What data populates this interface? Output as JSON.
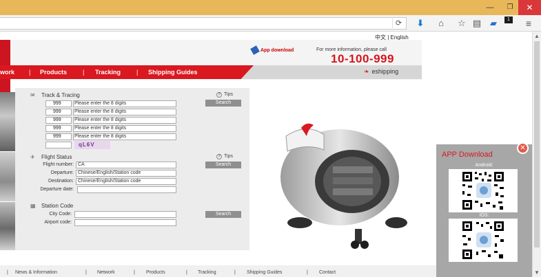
{
  "window": {
    "min_glyph": "—",
    "max_glyph": "❐",
    "close_glyph": "✕"
  },
  "toolbar": {
    "reload_glyph": "⟳",
    "icons": [
      "download-icon",
      "home-icon",
      "star-icon",
      "clipboard-icon",
      "chat-icon",
      "menu-icon"
    ],
    "badge": "1"
  },
  "header": {
    "lang": "中文 | English",
    "app_download": "App download",
    "more_info": "For more information, please call",
    "hotline": "10-100-999",
    "nav": [
      "work",
      "Products",
      "Tracking",
      "Shipping Guides"
    ],
    "eshipping": "eshipping"
  },
  "track": {
    "title": "Track & Tracing",
    "tips": "Tips",
    "search": "Search",
    "rows": [
      {
        "prefix": "999",
        "placeholder": "Please enter the 8 digits"
      },
      {
        "prefix": "999",
        "placeholder": "Please enter the 8 digits"
      },
      {
        "prefix": "999",
        "placeholder": "Please enter the 8 digits"
      },
      {
        "prefix": "999",
        "placeholder": "Please enter the 8 digits"
      },
      {
        "prefix": "999",
        "placeholder": "Please enter the 8 digits"
      }
    ],
    "captcha": "qL6V"
  },
  "flight": {
    "title": "Flight Status",
    "tips": "Tips",
    "search": "Search",
    "flight_number_label": "Flight number:",
    "flight_number_value": "CA",
    "departure_label": "Departure:",
    "departure_value": "Chinese/English/Station code",
    "destination_label": "Destination:",
    "destination_value": "Chinese/English/Station code",
    "date_label": "Departure date:"
  },
  "station": {
    "title": "Station Code",
    "search": "Search",
    "city_label": "City Code:",
    "airport_label": "Airport code:"
  },
  "footer": {
    "links": [
      "News & Information",
      "Network",
      "Products",
      "Tracking",
      "Shipping Guides",
      "Contact"
    ]
  },
  "popup": {
    "title": "APP Download",
    "android": "Android:",
    "ios": "IOS:"
  },
  "colors": {
    "brand_red": "#d91820",
    "titlebar": "#e8b75a",
    "popup_bg": "#a7a7a7"
  }
}
